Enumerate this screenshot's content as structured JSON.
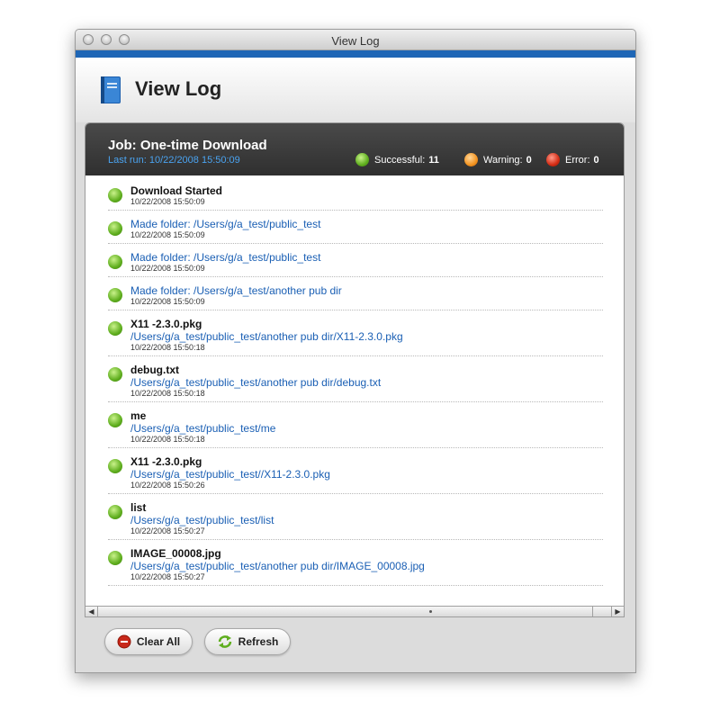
{
  "window": {
    "title": "View Log"
  },
  "header": {
    "title": "View Log"
  },
  "job": {
    "title": "Job: One-time Download",
    "last_run": "Last run: 10/22/2008 15:50:09",
    "stats": {
      "successful_label": "Successful:",
      "successful_count": "11",
      "warning_label": "Warning:",
      "warning_count": "0",
      "error_label": "Error:",
      "error_count": "0"
    }
  },
  "entries": [
    {
      "title": "Download Started",
      "title_is_link": false,
      "path": "",
      "time": "10/22/2008 15:50:09",
      "status": "success"
    },
    {
      "title": "Made folder: /Users/g/a_test/public_test",
      "title_is_link": true,
      "path": "",
      "time": "10/22/2008 15:50:09",
      "status": "success"
    },
    {
      "title": "Made folder: /Users/g/a_test/public_test",
      "title_is_link": true,
      "path": "",
      "time": "10/22/2008 15:50:09",
      "status": "success"
    },
    {
      "title": "Made folder: /Users/g/a_test/another pub dir",
      "title_is_link": true,
      "path": "",
      "time": "10/22/2008 15:50:09",
      "status": "success"
    },
    {
      "title": "X11 -2.3.0.pkg",
      "title_is_link": false,
      "path": "/Users/g/a_test/public_test/another pub dir/X11-2.3.0.pkg",
      "time": "10/22/2008 15:50:18",
      "status": "success"
    },
    {
      "title": "debug.txt",
      "title_is_link": false,
      "path": "/Users/g/a_test/public_test/another pub dir/debug.txt",
      "time": "10/22/2008 15:50:18",
      "status": "success"
    },
    {
      "title": "me",
      "title_is_link": false,
      "path": "/Users/g/a_test/public_test/me",
      "time": "10/22/2008 15:50:18",
      "status": "success"
    },
    {
      "title": "X11 -2.3.0.pkg",
      "title_is_link": false,
      "path": "/Users/g/a_test/public_test//X11-2.3.0.pkg",
      "time": "10/22/2008 15:50:26",
      "status": "success"
    },
    {
      "title": "list",
      "title_is_link": false,
      "path": "/Users/g/a_test/public_test/list",
      "time": "10/22/2008 15:50:27",
      "status": "success"
    },
    {
      "title": "IMAGE_00008.jpg",
      "title_is_link": false,
      "path": "/Users/g/a_test/public_test/another pub dir/IMAGE_00008.jpg",
      "time": "10/22/2008 15:50:27",
      "status": "success"
    }
  ],
  "buttons": {
    "clear_all": "Clear All",
    "refresh": "Refresh"
  },
  "icons": {
    "header": "book-icon",
    "clear": "minus-circle-icon",
    "refresh": "refresh-arrows-icon"
  },
  "colors": {
    "accent_bar": "#1e66b6",
    "link": "#1a5fb4",
    "success": "#5fae1e",
    "warning": "#f39320",
    "error": "#d42c14"
  }
}
